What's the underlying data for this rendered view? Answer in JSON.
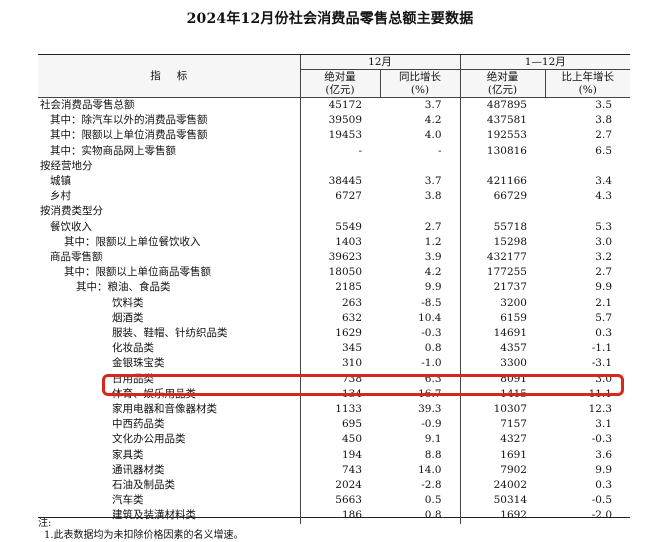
{
  "title": "2024年12月份社会消费品零售总额主要数据",
  "header": {
    "indicator": "指标",
    "group_dec": "12月",
    "group_ytd": "1—12月",
    "cols": [
      {
        "line1": "绝对量",
        "line2": "(亿元)"
      },
      {
        "line1": "同比增长",
        "line2": "(%)"
      },
      {
        "line1": "绝对量",
        "line2": "(亿元)"
      },
      {
        "line1": "比上年增长",
        "line2": "(%)"
      }
    ]
  },
  "rows": [
    {
      "label": "社会消费品零售总额",
      "level": 0,
      "v": [
        "45172",
        "3.7",
        "487895",
        "3.5"
      ]
    },
    {
      "label": "其中：除汽车以外的消费品零售额",
      "level": 1,
      "v": [
        "39509",
        "4.2",
        "437581",
        "3.8"
      ]
    },
    {
      "label": "其中：限额以上单位消费品零售额",
      "level": 1,
      "v": [
        "19453",
        "4.0",
        "192553",
        "2.7"
      ]
    },
    {
      "label": "其中：实物商品网上零售额",
      "level": 1,
      "v": [
        "-",
        "-",
        "130816",
        "6.5"
      ]
    },
    {
      "label": "按经营地分",
      "level": 0,
      "v": [
        "",
        "",
        "",
        ""
      ]
    },
    {
      "label": "城镇",
      "level": 1,
      "v": [
        "38445",
        "3.7",
        "421166",
        "3.4"
      ]
    },
    {
      "label": "乡村",
      "level": 1,
      "v": [
        "6727",
        "3.8",
        "66729",
        "4.3"
      ]
    },
    {
      "label": "按消费类型分",
      "level": 0,
      "v": [
        "",
        "",
        "",
        ""
      ]
    },
    {
      "label": "餐饮收入",
      "level": 1,
      "v": [
        "5549",
        "2.7",
        "55718",
        "5.3"
      ]
    },
    {
      "label": "其中：限额以上单位餐饮收入",
      "level": 2,
      "v": [
        "1403",
        "1.2",
        "15298",
        "3.0"
      ]
    },
    {
      "label": "商品零售额",
      "level": 1,
      "v": [
        "39623",
        "3.9",
        "432177",
        "3.2"
      ]
    },
    {
      "label": "其中：限额以上单位商品零售额",
      "level": 2,
      "v": [
        "18050",
        "4.2",
        "177255",
        "2.7"
      ]
    },
    {
      "label": "其中：粮油、食品类",
      "level": 3,
      "v": [
        "2185",
        "9.9",
        "21737",
        "9.9"
      ]
    },
    {
      "label": "饮料类",
      "level": 4,
      "v": [
        "263",
        "-8.5",
        "3200",
        "2.1"
      ]
    },
    {
      "label": "烟酒类",
      "level": 4,
      "v": [
        "632",
        "10.4",
        "6159",
        "5.7"
      ]
    },
    {
      "label": "服装、鞋帽、针纺织品类",
      "level": 4,
      "v": [
        "1629",
        "-0.3",
        "14691",
        "0.3"
      ]
    },
    {
      "label": "化妆品类",
      "level": 4,
      "v": [
        "345",
        "0.8",
        "4357",
        "-1.1"
      ]
    },
    {
      "label": "金银珠宝类",
      "level": 4,
      "v": [
        "310",
        "-1.0",
        "3300",
        "-3.1"
      ]
    },
    {
      "label": "日用品类",
      "level": 4,
      "v": [
        "738",
        "6.3",
        "8091",
        "3.0"
      ]
    },
    {
      "label": "体育、娱乐用品类",
      "level": 4,
      "v": [
        "134",
        "16.7",
        "1415",
        "11.1"
      ]
    },
    {
      "label": "家用电器和音像器材类",
      "level": 4,
      "v": [
        "1133",
        "39.3",
        "10307",
        "12.3"
      ]
    },
    {
      "label": "中西药品类",
      "level": 4,
      "v": [
        "695",
        "-0.9",
        "7157",
        "3.1"
      ]
    },
    {
      "label": "文化办公用品类",
      "level": 4,
      "v": [
        "450",
        "9.1",
        "4327",
        "-0.3"
      ]
    },
    {
      "label": "家具类",
      "level": 4,
      "v": [
        "194",
        "8.8",
        "1691",
        "3.6"
      ]
    },
    {
      "label": "通讯器材类",
      "level": 4,
      "v": [
        "743",
        "14.0",
        "7902",
        "9.9"
      ]
    },
    {
      "label": "石油及制品类",
      "level": 4,
      "v": [
        "2024",
        "-2.8",
        "24002",
        "0.3"
      ]
    },
    {
      "label": "汽车类",
      "level": 4,
      "v": [
        "5663",
        "0.5",
        "50314",
        "-0.5"
      ]
    },
    {
      "label": "建筑及装潢材料类",
      "level": 4,
      "v": [
        "186",
        "0.8",
        "1692",
        "-2.0"
      ]
    }
  ],
  "footnote": {
    "label": "注:",
    "line1": "1.此表数据均为未扣除价格因素的名义增速。"
  },
  "highlight_color": "#d9251c"
}
